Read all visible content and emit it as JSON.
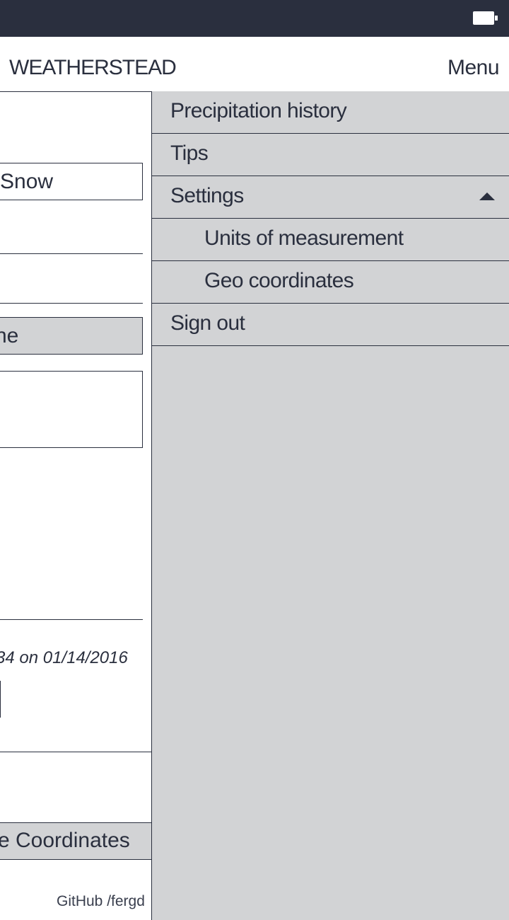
{
  "status_bar": {
    "icons": [
      "battery-icon"
    ]
  },
  "header": {
    "title": "WEATHERSTEAD",
    "menu_label": "Menu"
  },
  "background_page": {
    "precipitation_select_value": "Snow",
    "type_button_partial": "ne",
    "last_updated_partial": "34 on 01/14/2016",
    "coordinates_button_partial": "e Coordinates",
    "footer_partial": "GitHub /fergd"
  },
  "menu": {
    "items": [
      {
        "label": "Precipitation history"
      },
      {
        "label": "Tips"
      },
      {
        "label": "Settings",
        "expanded": true
      },
      {
        "label": "Units of measurement",
        "sub": true
      },
      {
        "label": "Geo coordinates",
        "sub": true
      },
      {
        "label": "Sign out"
      }
    ]
  },
  "colors": {
    "dark": "#2a2f3e",
    "drawer_bg": "#d2d3d5",
    "page_bg": "#ffffff"
  }
}
